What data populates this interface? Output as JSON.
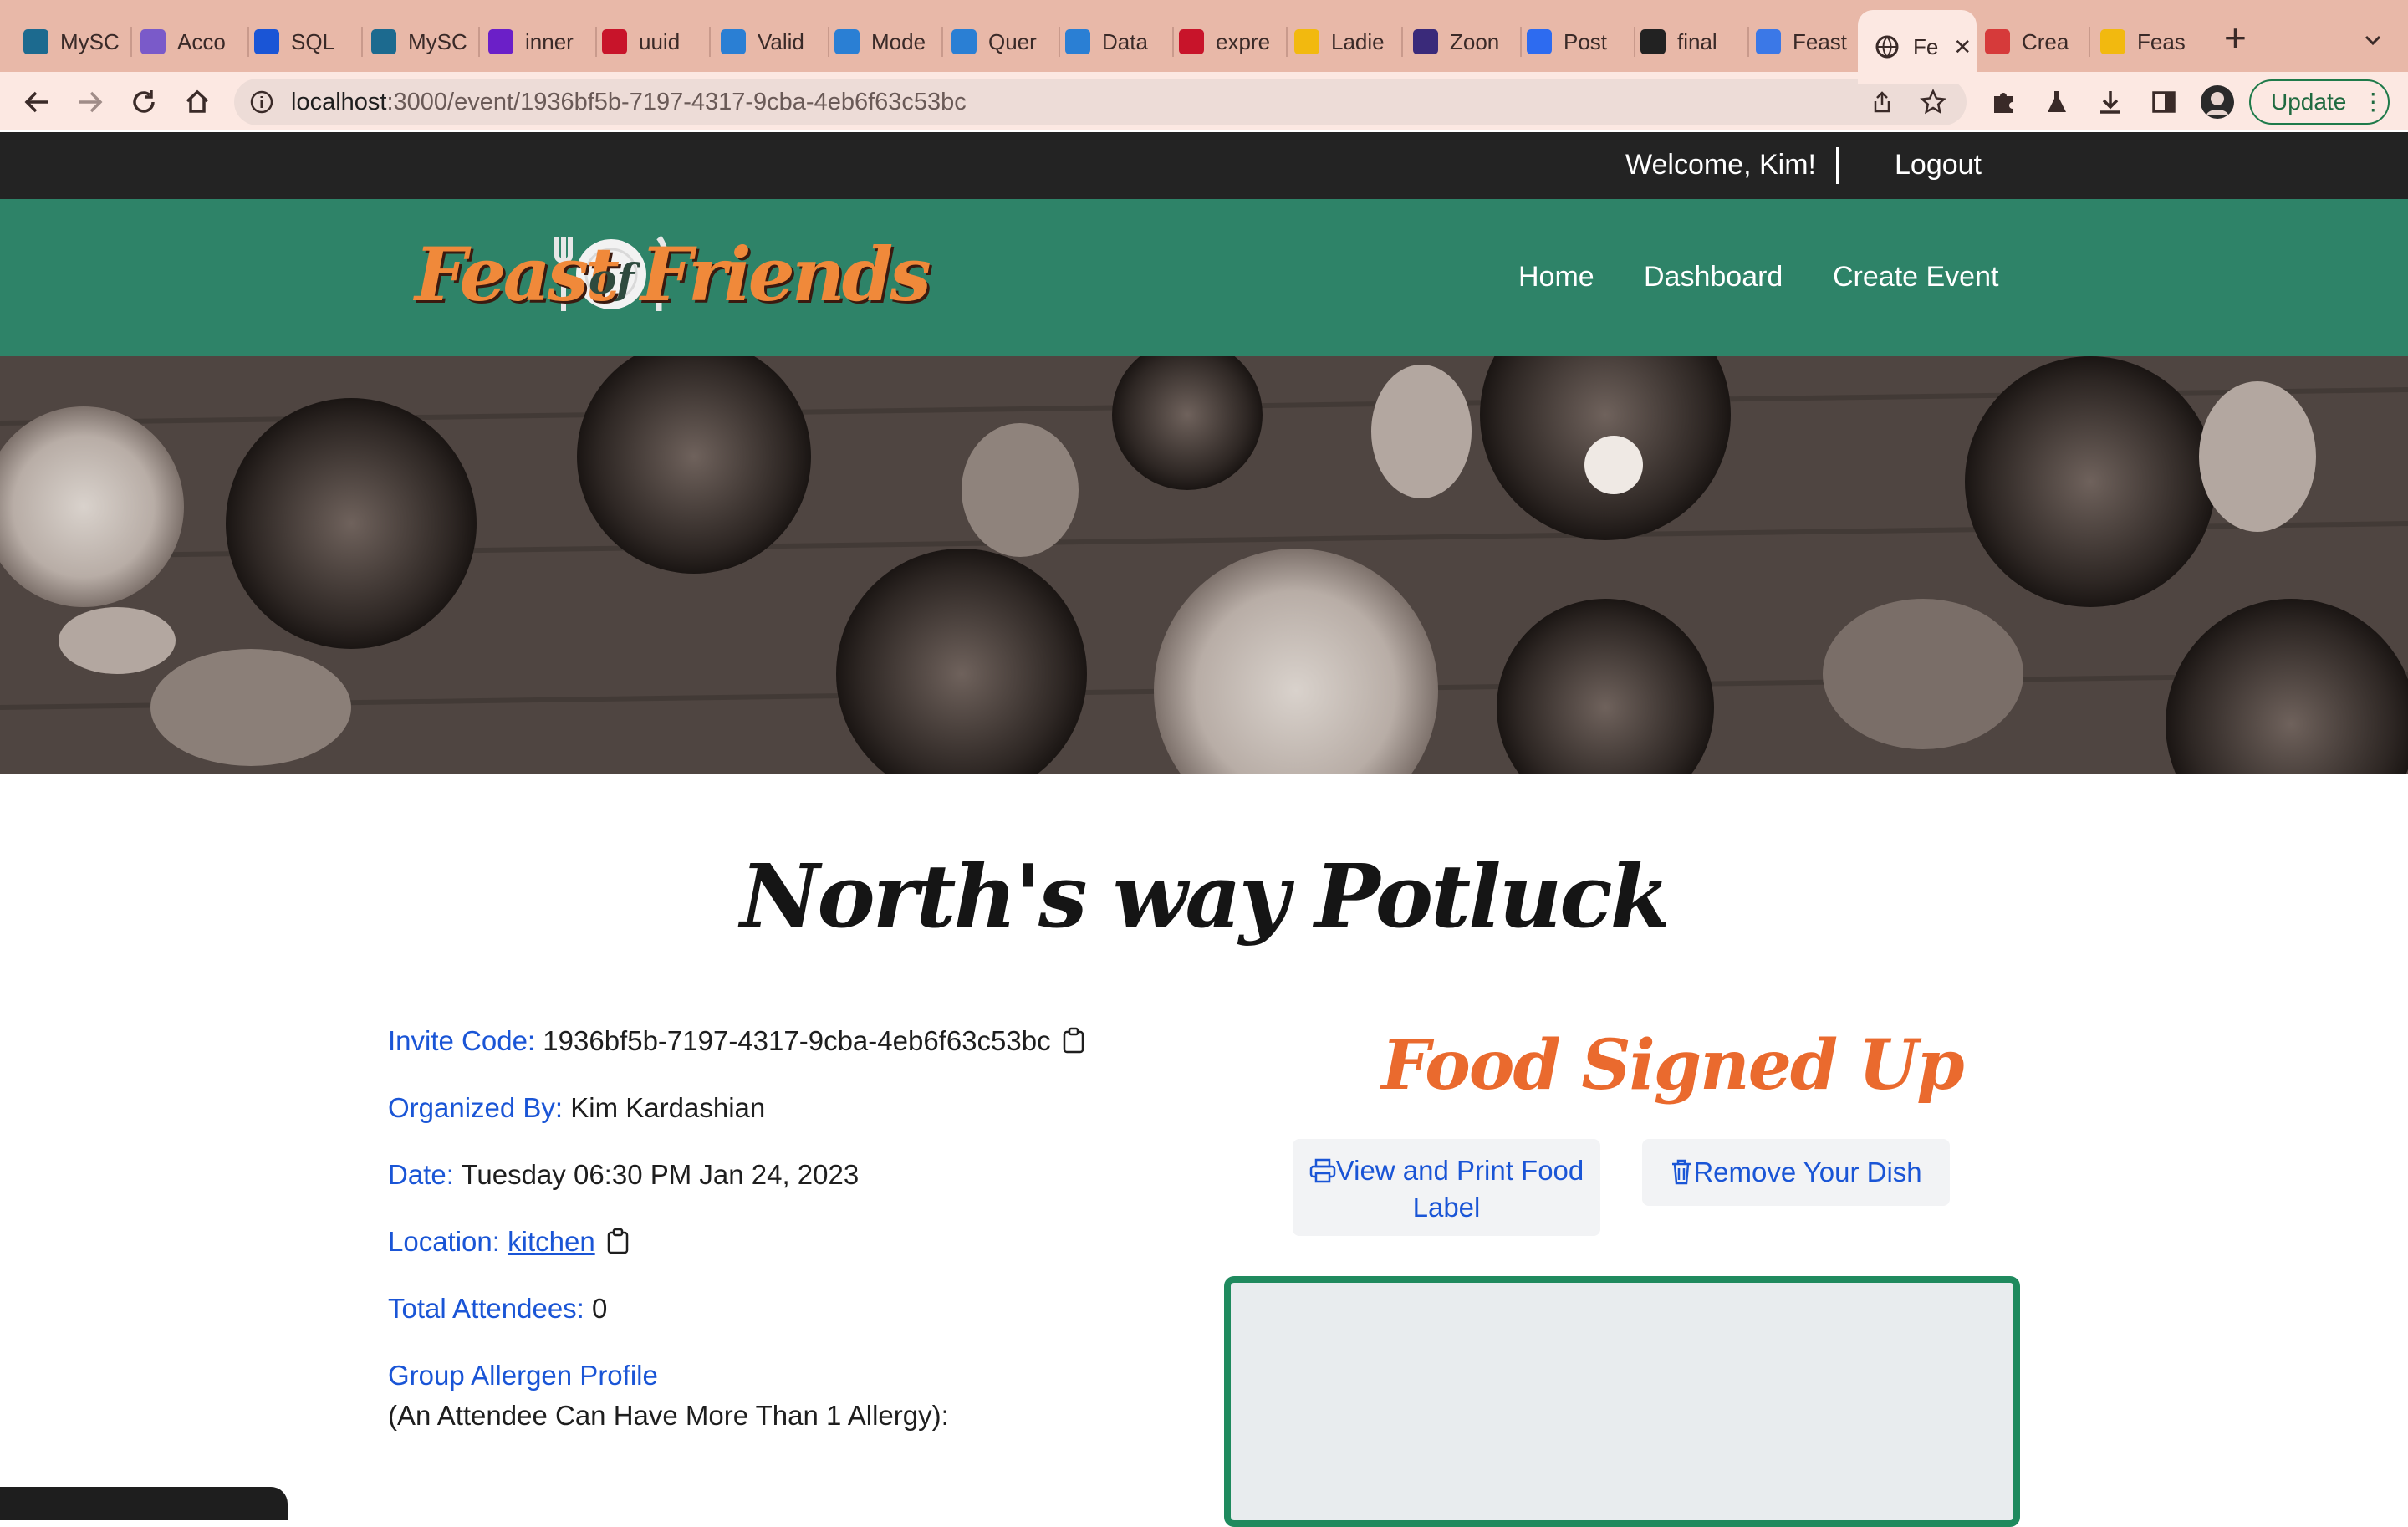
{
  "browser": {
    "tabs": [
      {
        "label": "MySC",
        "icon": "mysql-icon",
        "color": "#1c6a8f"
      },
      {
        "label": "Acco",
        "icon": "heroku-icon",
        "color": "#7a5ac9"
      },
      {
        "label": "SQL",
        "icon": "dot-icon",
        "color": "#1a55d6"
      },
      {
        "label": "MySC",
        "icon": "mysql-icon",
        "color": "#1c6a8f"
      },
      {
        "label": "inner",
        "icon": "yahoo-icon",
        "color": "#6b1fc8"
      },
      {
        "label": "uuid",
        "icon": "npm-icon",
        "color": "#c8142a"
      },
      {
        "label": "Valid",
        "icon": "cube-icon",
        "color": "#2a7fd4"
      },
      {
        "label": "Mode",
        "icon": "cube-icon",
        "color": "#2a7fd4"
      },
      {
        "label": "Quer",
        "icon": "cube-icon",
        "color": "#2a7fd4"
      },
      {
        "label": "Data",
        "icon": "cube-icon",
        "color": "#2a7fd4"
      },
      {
        "label": "expre",
        "icon": "npm-icon",
        "color": "#c8142a"
      },
      {
        "label": "Ladie",
        "icon": "slides-icon",
        "color": "#f2b90f"
      },
      {
        "label": "Zoon",
        "icon": "notion-icon",
        "color": "#3a2a7a"
      },
      {
        "label": "Post",
        "icon": "zoom-icon",
        "color": "#2d6bf0"
      },
      {
        "label": "final",
        "icon": "github-icon",
        "color": "#222222"
      },
      {
        "label": "Feast",
        "icon": "docs-icon",
        "color": "#3b78e7"
      }
    ],
    "active_tab": {
      "label": "Fe",
      "close": "✕"
    },
    "tabs_after": [
      {
        "label": "Crea",
        "icon": "swoosh-icon",
        "color": "#d63a3a"
      },
      {
        "label": "Feas",
        "icon": "slides-icon",
        "color": "#f2b90f"
      }
    ],
    "new_tab": "+",
    "tab_menu": "⌄",
    "url_host": "localhost",
    "url_path": ":3000/event/1936bf5b-7197-4317-9cba-4eb6f63c53bc",
    "update_label": "Update"
  },
  "site": {
    "welcome": "Welcome, Kim!",
    "logout": "Logout",
    "logo_part1": "Feast",
    "logo_part2": "of",
    "logo_part3": "Friends",
    "nav": [
      "Home",
      "Dashboard",
      "Create Event"
    ]
  },
  "event": {
    "title": "North's way Potluck",
    "invite_label": "Invite Code:",
    "invite_value": "1936bf5b-7197-4317-9cba-4eb6f63c53bc",
    "organizer_label": "Organized By:",
    "organizer_value": "Kim Kardashian",
    "date_label": "Date:",
    "date_value": "Tuesday 06:30 PM Jan 24, 2023",
    "location_label": "Location:",
    "location_value": "kitchen",
    "attendees_label": "Total Attendees:",
    "attendees_value": "0",
    "allergen_label": "Group Allergen Profile",
    "allergen_note": "(An Attendee Can Have More Than 1 Allergy):"
  },
  "food": {
    "title": "Food Signed Up",
    "print_label": "View and Print Food Label",
    "remove_label": "Remove Your Dish"
  },
  "colors": {
    "nav_green": "#2e8368",
    "accent_orange": "#ea6a2e",
    "link_blue": "#1a55d6",
    "box_border": "#1f8a5e"
  }
}
